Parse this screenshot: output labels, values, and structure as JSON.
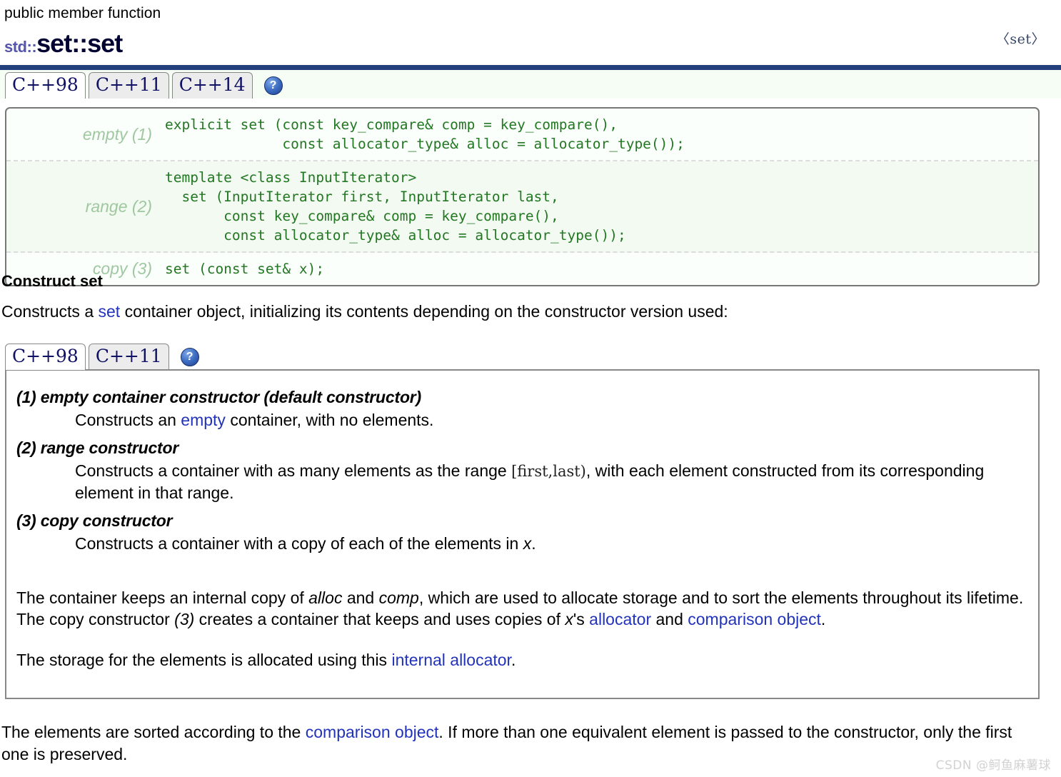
{
  "header": {
    "kicker": "public member function",
    "title_std": "std::",
    "title_main": "set::set",
    "include": "〈set〉"
  },
  "colors": {
    "navy_rule": "#24407c",
    "link": "#2233bb",
    "code_green": "#227722",
    "label_green": "#9fc7a0",
    "title_blue": "#000033",
    "std_blue": "#5555aa",
    "panel_border": "#777777",
    "tab_inactive_bg": "#ececec",
    "tab_strip_bg": "#f5fdf4",
    "watermark": "#d2d2d2"
  },
  "signature_tabs": {
    "items": [
      {
        "label": "C++98",
        "active": true
      },
      {
        "label": "C++11",
        "active": false
      },
      {
        "label": "C++14",
        "active": false
      }
    ],
    "help_icon": "help-question-icon",
    "help_glyph": "?"
  },
  "signatures": [
    {
      "label": "empty (1)",
      "code": "explicit set (const key_compare& comp = key_compare(),\n              const allocator_type& alloc = allocator_type());"
    },
    {
      "label": "range (2)",
      "code": "template <class InputIterator>\n  set (InputIterator first, InputIterator last,\n       const key_compare& comp = key_compare(),\n       const allocator_type& alloc = allocator_type());"
    },
    {
      "label": "copy (3)",
      "code": "set (const set& x);"
    }
  ],
  "section": {
    "heading": "Construct set",
    "intro_before": "Constructs a ",
    "intro_link": "set",
    "intro_after": " container object, initializing its contents depending on the constructor version used:"
  },
  "description_tabs": {
    "items": [
      {
        "label": "C++98",
        "active": true
      },
      {
        "label": "C++11",
        "active": false
      }
    ],
    "help_icon": "help-question-icon",
    "help_glyph": "?"
  },
  "constructors": [
    {
      "title": "(1) empty container constructor (default constructor)",
      "body_parts": [
        {
          "text": "Constructs an ",
          "style": "plain"
        },
        {
          "text": "empty",
          "style": "link"
        },
        {
          "text": " container, with no elements.",
          "style": "plain"
        }
      ]
    },
    {
      "title": "(2) range constructor",
      "body_parts": [
        {
          "text": "Constructs a container with as many elements as the range ",
          "style": "plain"
        },
        {
          "text": "[first,last)",
          "style": "mono"
        },
        {
          "text": ", with each element constructed from its corresponding element in that range.",
          "style": "plain"
        }
      ]
    },
    {
      "title": "(3) copy constructor",
      "body_parts": [
        {
          "text": "Constructs a container with a copy of each of the elements in ",
          "style": "plain"
        },
        {
          "text": "x",
          "style": "italic"
        },
        {
          "text": ".",
          "style": "plain"
        }
      ]
    }
  ],
  "notes": {
    "p1": [
      {
        "text": "The container keeps an internal copy of ",
        "style": "plain"
      },
      {
        "text": "alloc",
        "style": "italic"
      },
      {
        "text": " and ",
        "style": "plain"
      },
      {
        "text": "comp",
        "style": "italic"
      },
      {
        "text": ", which are used to allocate storage and to sort the elements throughout its lifetime.",
        "style": "plain"
      }
    ],
    "p2": [
      {
        "text": "The copy constructor ",
        "style": "plain"
      },
      {
        "text": "(3)",
        "style": "italic"
      },
      {
        "text": " creates a container that keeps and uses copies of ",
        "style": "plain"
      },
      {
        "text": "x",
        "style": "italic"
      },
      {
        "text": "'s ",
        "style": "plain"
      },
      {
        "text": "allocator",
        "style": "link"
      },
      {
        "text": " and ",
        "style": "plain"
      },
      {
        "text": "comparison object",
        "style": "link"
      },
      {
        "text": ".",
        "style": "plain"
      }
    ],
    "p3": [
      {
        "text": "The storage for the elements is allocated using this ",
        "style": "plain"
      },
      {
        "text": "internal allocator",
        "style": "link"
      },
      {
        "text": ".",
        "style": "plain"
      }
    ]
  },
  "trailing": [
    {
      "text": "The elements are sorted according to the ",
      "style": "plain"
    },
    {
      "text": "comparison object",
      "style": "link"
    },
    {
      "text": ". If more than one equivalent element is passed to the constructor, only the first one is preserved.",
      "style": "plain"
    }
  ],
  "watermark": "CSDN @鲄鱼麻薯球"
}
